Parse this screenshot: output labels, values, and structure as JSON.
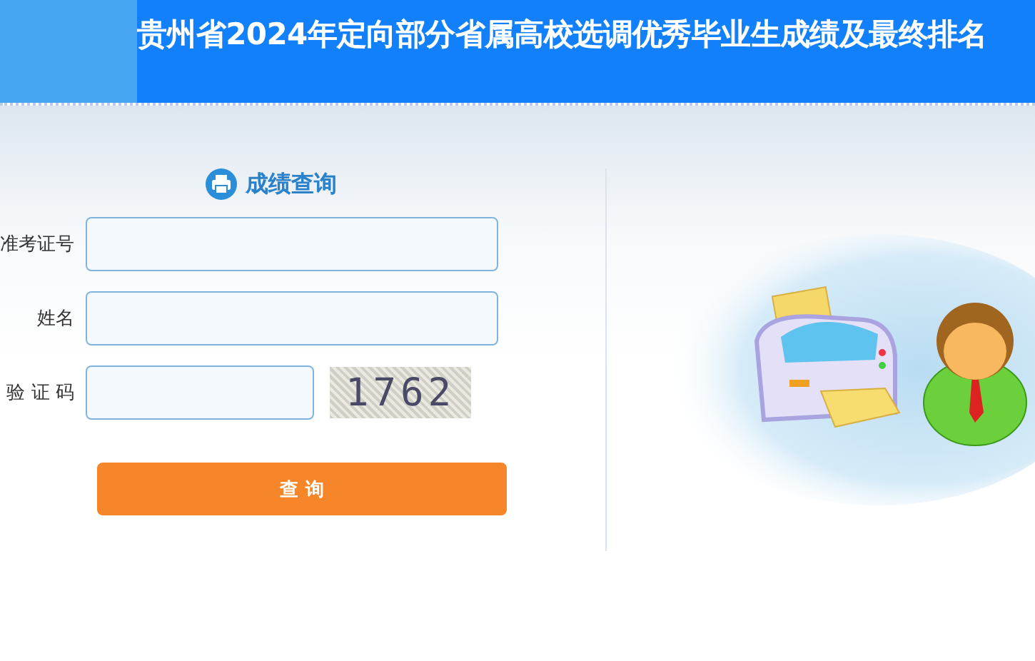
{
  "header": {
    "title": "贵州省2024年定向部分省属高校选调优秀毕业生成绩及最终排名"
  },
  "form": {
    "title": "成绩查询",
    "fields": [
      {
        "label": "准考证号",
        "kind": "text"
      },
      {
        "label": "姓名",
        "kind": "text"
      },
      {
        "label": "验 证 码",
        "kind": "captcha",
        "captcha": "1762"
      }
    ],
    "submit": "查 询"
  }
}
